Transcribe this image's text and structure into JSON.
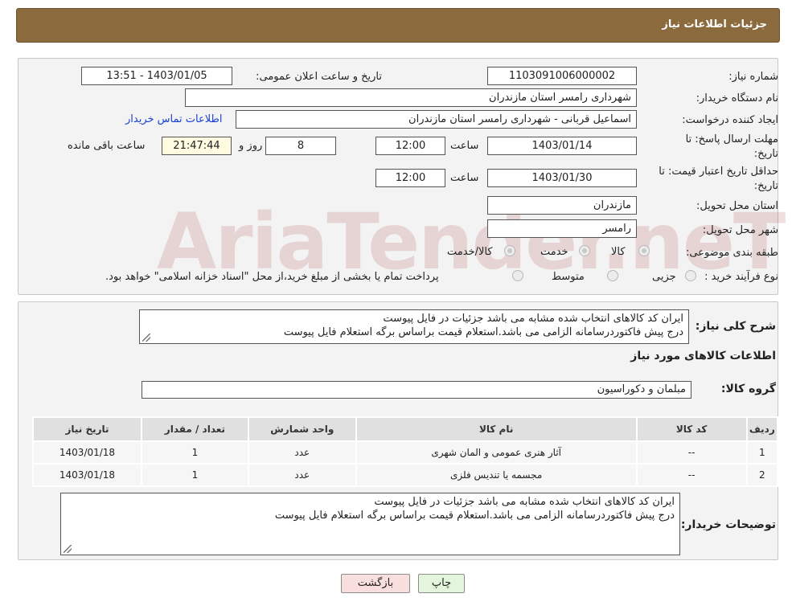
{
  "header": {
    "title": "جزئیات اطلاعات نیاز"
  },
  "form": {
    "need_number_label": "شماره نیاز:",
    "need_number": "1103091006000002",
    "announce_label": "تاریخ و ساعت اعلان عمومی:",
    "announce_value": "1403/01/05 - 13:51",
    "buyer_org_label": "نام دستگاه خریدار:",
    "buyer_org": "شهرداری رامسر استان مازندران",
    "creator_label": "ایجاد کننده درخواست:",
    "creator": "اسماعیل قربانی - شهرداری رامسر استان مازندران",
    "contact_link": "اطلاعات تماس خریدار",
    "deadline_label_1": "مهلت ارسال پاسخ: تا",
    "deadline_label_2": "تاریخ:",
    "deadline_date": "1403/01/14",
    "time_label": "ساعت",
    "deadline_time": "12:00",
    "days_value": "8",
    "days_label": "روز و",
    "remaining_time": "21:47:44",
    "remaining_label": "ساعت باقی مانده",
    "validity_label_1": "حداقل تاریخ اعتبار قیمت: تا",
    "validity_label_2": "تاریخ:",
    "validity_date": "1403/01/30",
    "validity_time": "12:00",
    "province_label": "استان محل تحویل:",
    "province": "مازندران",
    "city_label": "شهر محل تحویل:",
    "city": "رامسر",
    "category_label": "طبقه بندی موضوعی:",
    "category_options": [
      "کالا",
      "خدمت",
      "کالا/خدمت"
    ],
    "process_label": "نوع فرآیند خرید :",
    "process_options": [
      "جزیی",
      "متوسط"
    ],
    "process_note": "پرداخت تمام یا بخشی از مبلغ خرید،از محل \"اسناد خزانه اسلامی\" خواهد بود."
  },
  "description": {
    "label": "شرح کلی نیاز:",
    "line1": "ایران کد کالاهای انتخاب شده مشابه می باشد جزئیات در فایل پیوست",
    "line2": "درج پیش فاکتوردرسامانه الزامی می باشد.استعلام قیمت براساس برگه استعلام فایل پیوست"
  },
  "goods": {
    "section_title": "اطلاعات کالاهای مورد نیاز",
    "group_label": "گروه کالا:",
    "group_value": "مبلمان و دکوراسیون",
    "columns": [
      "ردیف",
      "کد کالا",
      "نام کالا",
      "واحد شمارش",
      "تعداد / مقدار",
      "تاریخ نیاز"
    ],
    "rows": [
      {
        "row": "1",
        "code": "--",
        "name": "آثار هنری عمومی و المان شهری",
        "unit": "عدد",
        "qty": "1",
        "date": "1403/01/18"
      },
      {
        "row": "2",
        "code": "--",
        "name": "مجسمه یا تندیس فلزی",
        "unit": "عدد",
        "qty": "1",
        "date": "1403/01/18"
      }
    ]
  },
  "buyer_notes": {
    "label": "توضیحات خریدار:",
    "line1": "ایران کد کالاهای انتخاب شده مشابه می باشد جزئیات در فایل پیوست",
    "line2": "درج پیش فاکتوردرسامانه الزامی می باشد.استعلام قیمت براساس برگه استعلام فایل پیوست"
  },
  "buttons": {
    "print": "چاپ",
    "back": "بازگشت"
  },
  "watermark": "AriaTender.neT"
}
